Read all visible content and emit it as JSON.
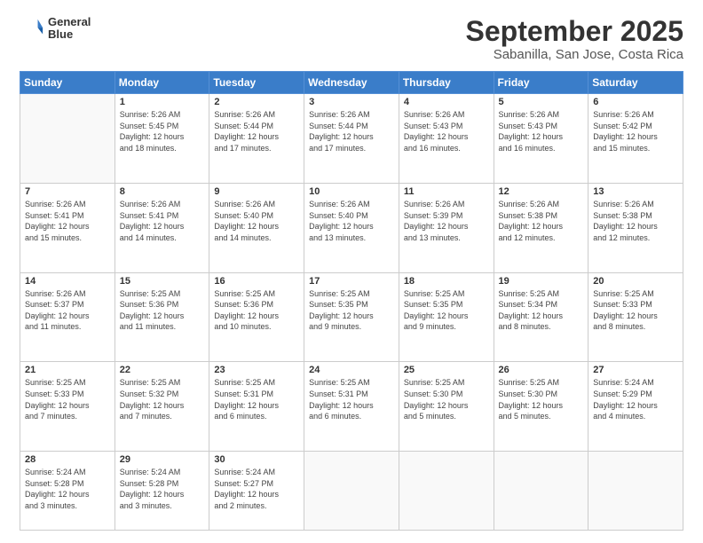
{
  "logo": {
    "line1": "General",
    "line2": "Blue"
  },
  "title": "September 2025",
  "subtitle": "Sabanilla, San Jose, Costa Rica",
  "weekdays": [
    "Sunday",
    "Monday",
    "Tuesday",
    "Wednesday",
    "Thursday",
    "Friday",
    "Saturday"
  ],
  "weeks": [
    [
      {
        "day": "",
        "info": ""
      },
      {
        "day": "1",
        "info": "Sunrise: 5:26 AM\nSunset: 5:45 PM\nDaylight: 12 hours\nand 18 minutes."
      },
      {
        "day": "2",
        "info": "Sunrise: 5:26 AM\nSunset: 5:44 PM\nDaylight: 12 hours\nand 17 minutes."
      },
      {
        "day": "3",
        "info": "Sunrise: 5:26 AM\nSunset: 5:44 PM\nDaylight: 12 hours\nand 17 minutes."
      },
      {
        "day": "4",
        "info": "Sunrise: 5:26 AM\nSunset: 5:43 PM\nDaylight: 12 hours\nand 16 minutes."
      },
      {
        "day": "5",
        "info": "Sunrise: 5:26 AM\nSunset: 5:43 PM\nDaylight: 12 hours\nand 16 minutes."
      },
      {
        "day": "6",
        "info": "Sunrise: 5:26 AM\nSunset: 5:42 PM\nDaylight: 12 hours\nand 15 minutes."
      }
    ],
    [
      {
        "day": "7",
        "info": "Sunrise: 5:26 AM\nSunset: 5:41 PM\nDaylight: 12 hours\nand 15 minutes."
      },
      {
        "day": "8",
        "info": "Sunrise: 5:26 AM\nSunset: 5:41 PM\nDaylight: 12 hours\nand 14 minutes."
      },
      {
        "day": "9",
        "info": "Sunrise: 5:26 AM\nSunset: 5:40 PM\nDaylight: 12 hours\nand 14 minutes."
      },
      {
        "day": "10",
        "info": "Sunrise: 5:26 AM\nSunset: 5:40 PM\nDaylight: 12 hours\nand 13 minutes."
      },
      {
        "day": "11",
        "info": "Sunrise: 5:26 AM\nSunset: 5:39 PM\nDaylight: 12 hours\nand 13 minutes."
      },
      {
        "day": "12",
        "info": "Sunrise: 5:26 AM\nSunset: 5:38 PM\nDaylight: 12 hours\nand 12 minutes."
      },
      {
        "day": "13",
        "info": "Sunrise: 5:26 AM\nSunset: 5:38 PM\nDaylight: 12 hours\nand 12 minutes."
      }
    ],
    [
      {
        "day": "14",
        "info": "Sunrise: 5:26 AM\nSunset: 5:37 PM\nDaylight: 12 hours\nand 11 minutes."
      },
      {
        "day": "15",
        "info": "Sunrise: 5:25 AM\nSunset: 5:36 PM\nDaylight: 12 hours\nand 11 minutes."
      },
      {
        "day": "16",
        "info": "Sunrise: 5:25 AM\nSunset: 5:36 PM\nDaylight: 12 hours\nand 10 minutes."
      },
      {
        "day": "17",
        "info": "Sunrise: 5:25 AM\nSunset: 5:35 PM\nDaylight: 12 hours\nand 9 minutes."
      },
      {
        "day": "18",
        "info": "Sunrise: 5:25 AM\nSunset: 5:35 PM\nDaylight: 12 hours\nand 9 minutes."
      },
      {
        "day": "19",
        "info": "Sunrise: 5:25 AM\nSunset: 5:34 PM\nDaylight: 12 hours\nand 8 minutes."
      },
      {
        "day": "20",
        "info": "Sunrise: 5:25 AM\nSunset: 5:33 PM\nDaylight: 12 hours\nand 8 minutes."
      }
    ],
    [
      {
        "day": "21",
        "info": "Sunrise: 5:25 AM\nSunset: 5:33 PM\nDaylight: 12 hours\nand 7 minutes."
      },
      {
        "day": "22",
        "info": "Sunrise: 5:25 AM\nSunset: 5:32 PM\nDaylight: 12 hours\nand 7 minutes."
      },
      {
        "day": "23",
        "info": "Sunrise: 5:25 AM\nSunset: 5:31 PM\nDaylight: 12 hours\nand 6 minutes."
      },
      {
        "day": "24",
        "info": "Sunrise: 5:25 AM\nSunset: 5:31 PM\nDaylight: 12 hours\nand 6 minutes."
      },
      {
        "day": "25",
        "info": "Sunrise: 5:25 AM\nSunset: 5:30 PM\nDaylight: 12 hours\nand 5 minutes."
      },
      {
        "day": "26",
        "info": "Sunrise: 5:25 AM\nSunset: 5:30 PM\nDaylight: 12 hours\nand 5 minutes."
      },
      {
        "day": "27",
        "info": "Sunrise: 5:24 AM\nSunset: 5:29 PM\nDaylight: 12 hours\nand 4 minutes."
      }
    ],
    [
      {
        "day": "28",
        "info": "Sunrise: 5:24 AM\nSunset: 5:28 PM\nDaylight: 12 hours\nand 3 minutes."
      },
      {
        "day": "29",
        "info": "Sunrise: 5:24 AM\nSunset: 5:28 PM\nDaylight: 12 hours\nand 3 minutes."
      },
      {
        "day": "30",
        "info": "Sunrise: 5:24 AM\nSunset: 5:27 PM\nDaylight: 12 hours\nand 2 minutes."
      },
      {
        "day": "",
        "info": ""
      },
      {
        "day": "",
        "info": ""
      },
      {
        "day": "",
        "info": ""
      },
      {
        "day": "",
        "info": ""
      }
    ]
  ]
}
